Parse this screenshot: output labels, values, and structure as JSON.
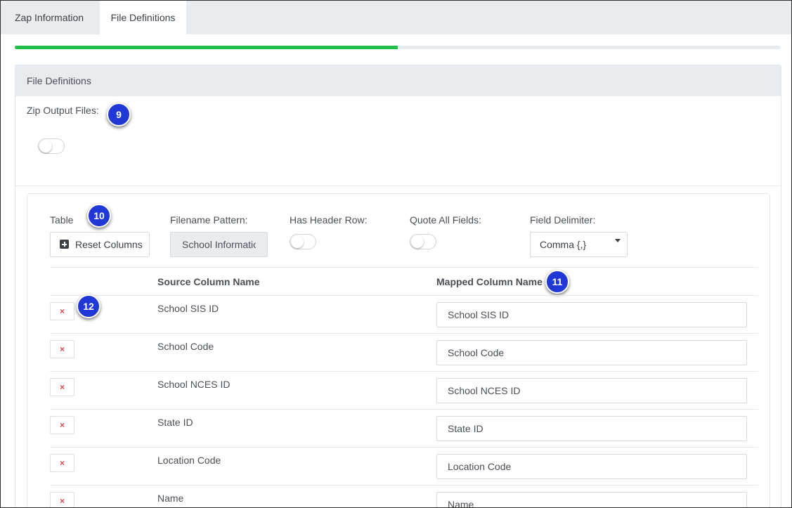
{
  "tabs": [
    {
      "label": "Zap Information",
      "active": false
    },
    {
      "label": "File Definitions",
      "active": true
    }
  ],
  "progress": {
    "fraction": 0.5,
    "color": "#22c04b"
  },
  "card": {
    "header": "File Definitions",
    "zip_label": "Zip Output Files:",
    "zip_enabled": false
  },
  "table_panel": {
    "table_label": "Table",
    "reset_label": "Reset Columns",
    "filename_label": "Filename Pattern:",
    "filename_value": "School Information",
    "header_row_label": "Has Header Row:",
    "header_row_enabled": false,
    "quote_label": "Quote All Fields:",
    "quote_enabled": false,
    "delimiter_label": "Field Delimiter:",
    "delimiter_value": "Comma {,}"
  },
  "columns": {
    "source_header": "Source Column Name",
    "mapped_header": "Mapped Column Name",
    "remove_symbol": "×",
    "rows": [
      {
        "source": "School SIS ID",
        "mapped": "School SIS ID"
      },
      {
        "source": "School Code",
        "mapped": "School Code"
      },
      {
        "source": "School NCES ID",
        "mapped": "School NCES ID"
      },
      {
        "source": "State ID",
        "mapped": "State ID"
      },
      {
        "source": "Location Code",
        "mapped": "Location Code"
      },
      {
        "source": "Name",
        "mapped": "Name"
      }
    ]
  },
  "markers": [
    "9",
    "10",
    "11",
    "12"
  ],
  "colors": {
    "marker": "#1f38d6",
    "remove": "#e0424a",
    "accent": "#22c04b"
  }
}
